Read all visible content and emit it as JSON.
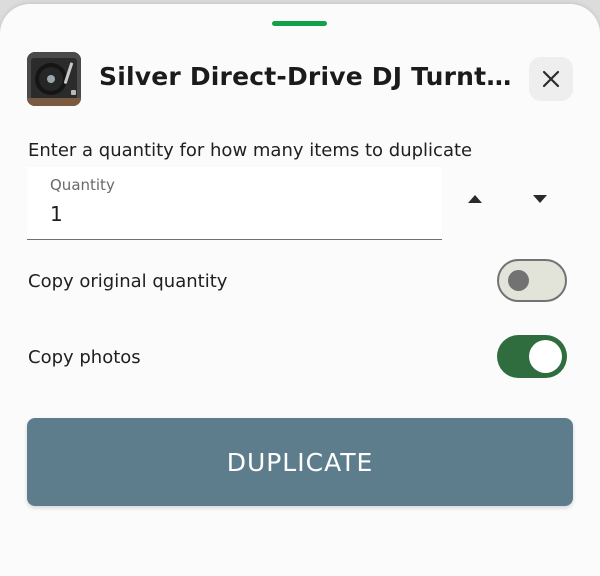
{
  "sheet": {
    "title": "Silver Direct-Drive DJ Turntable",
    "instruction": "Enter a quantity for how many items to duplicate"
  },
  "quantity": {
    "label": "Quantity",
    "value": "1"
  },
  "options": {
    "copy_quantity_label": "Copy original quantity",
    "copy_quantity_on": false,
    "copy_photos_label": "Copy photos",
    "copy_photos_on": true
  },
  "actions": {
    "duplicate_label": "DUPLICATE"
  },
  "colors": {
    "accent": "#12a04a",
    "toggle_on": "#2f6d3f",
    "button": "#5e7d8c"
  }
}
